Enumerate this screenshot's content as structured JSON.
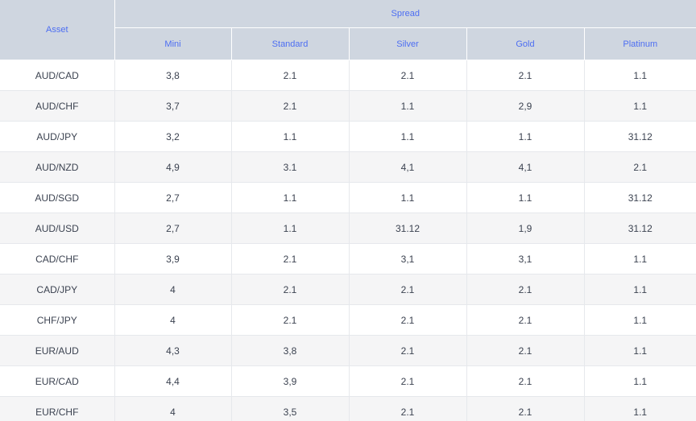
{
  "header": {
    "asset_label": "Asset",
    "spread_label": "Spread",
    "columns": [
      "Mini",
      "Standard",
      "Silver",
      "Gold",
      "Platinum"
    ]
  },
  "rows": [
    {
      "asset": "AUD/CAD",
      "values": [
        "3,8",
        "2.1",
        "2.1",
        "2.1",
        "1.1"
      ]
    },
    {
      "asset": "AUD/CHF",
      "values": [
        "3,7",
        "2.1",
        "1.1",
        "2,9",
        "1.1"
      ]
    },
    {
      "asset": "AUD/JPY",
      "values": [
        "3,2",
        "1.1",
        "1.1",
        "1.1",
        "31.12"
      ]
    },
    {
      "asset": "AUD/NZD",
      "values": [
        "4,9",
        "3.1",
        "4,1",
        "4,1",
        "2.1"
      ]
    },
    {
      "asset": "AUD/SGD",
      "values": [
        "2,7",
        "1.1",
        "1.1",
        "1.1",
        "31.12"
      ]
    },
    {
      "asset": "AUD/USD",
      "values": [
        "2,7",
        "1.1",
        "31.12",
        "1,9",
        "31.12"
      ]
    },
    {
      "asset": "CAD/CHF",
      "values": [
        "3,9",
        "2.1",
        "3,1",
        "3,1",
        "1.1"
      ]
    },
    {
      "asset": "CAD/JPY",
      "values": [
        "4",
        "2.1",
        "2.1",
        "2.1",
        "1.1"
      ]
    },
    {
      "asset": "CHF/JPY",
      "values": [
        "4",
        "2.1",
        "2.1",
        "2.1",
        "1.1"
      ]
    },
    {
      "asset": "EUR/AUD",
      "values": [
        "4,3",
        "3,8",
        "2.1",
        "2.1",
        "1.1"
      ]
    },
    {
      "asset": "EUR/CAD",
      "values": [
        "4,4",
        "3,9",
        "2.1",
        "2.1",
        "1.1"
      ]
    },
    {
      "asset": "EUR/CHF",
      "values": [
        "4",
        "3,5",
        "2.1",
        "2.1",
        "1.1"
      ]
    }
  ]
}
